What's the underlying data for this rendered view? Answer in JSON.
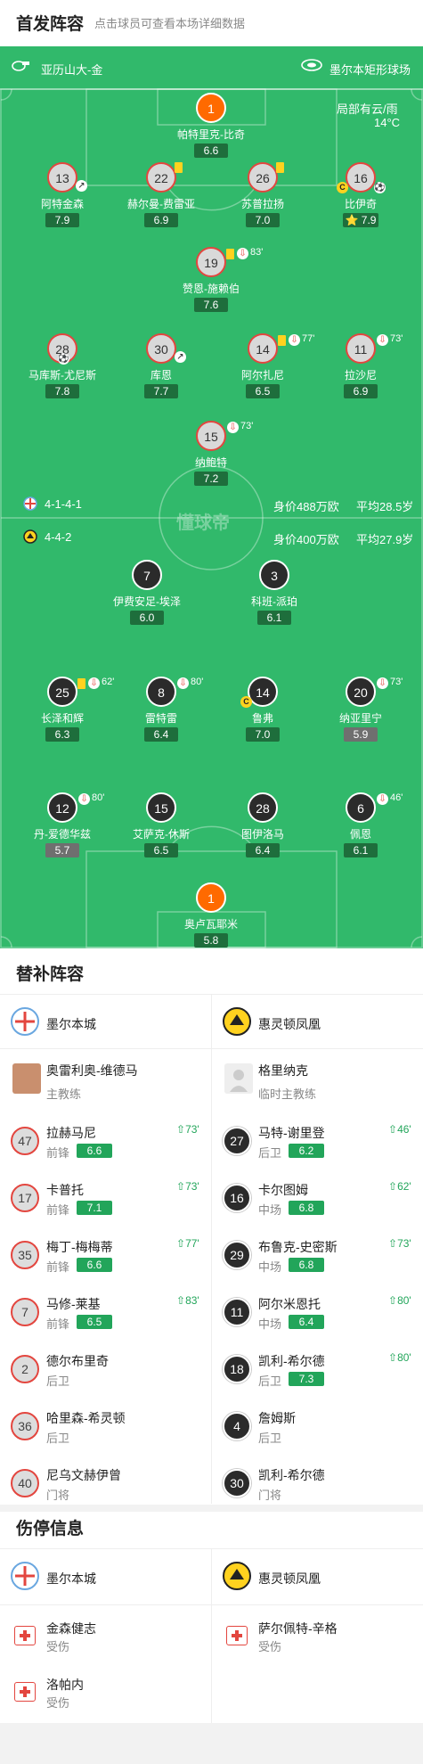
{
  "header": {
    "title": "首发阵容",
    "subtitle": "点击球员可查看本场详细数据"
  },
  "pitch": {
    "home_coach": "亚历山大-金",
    "stadium": "墨尔本矩形球场",
    "weather": "局部有云/雨",
    "temperature": "14°C",
    "watermark": "懂球帝"
  },
  "home": {
    "formation": "4-1-4-1",
    "value": "身价488万欧",
    "age": "平均28.5岁",
    "players": [
      {
        "num": "1",
        "name": "帕特里克-比奇",
        "rating": "6.6"
      },
      {
        "num": "13",
        "name": "阿特金森",
        "rating": "7.9"
      },
      {
        "num": "22",
        "name": "赫尔曼-费雷亚",
        "rating": "6.9"
      },
      {
        "num": "26",
        "name": "苏普拉扬",
        "rating": "7.0"
      },
      {
        "num": "16",
        "name": "比伊奇",
        "rating": "7.9"
      },
      {
        "num": "19",
        "name": "赞恩-施赖伯",
        "rating": "7.6",
        "minute": "83'"
      },
      {
        "num": "28",
        "name": "马库斯-尤尼斯",
        "rating": "7.8"
      },
      {
        "num": "30",
        "name": "库恩",
        "rating": "7.7"
      },
      {
        "num": "14",
        "name": "阿尔扎尼",
        "rating": "6.5",
        "minute": "77'"
      },
      {
        "num": "11",
        "name": "拉沙尼",
        "rating": "6.9",
        "minute": "73'"
      },
      {
        "num": "15",
        "name": "纳鲍特",
        "rating": "7.2",
        "minute": "73'"
      }
    ]
  },
  "away": {
    "formation": "4-4-2",
    "value": "身价400万欧",
    "age": "平均27.9岁",
    "players": [
      {
        "num": "7",
        "name": "伊费安足-埃泽",
        "rating": "6.0"
      },
      {
        "num": "3",
        "name": "科班-派珀",
        "rating": "6.1"
      },
      {
        "num": "25",
        "name": "长泽和辉",
        "rating": "6.3",
        "minute": "62'"
      },
      {
        "num": "8",
        "name": "雷特雷",
        "rating": "6.4",
        "minute": "80'"
      },
      {
        "num": "14",
        "name": "鲁弗",
        "rating": "7.0"
      },
      {
        "num": "20",
        "name": "纳亚里宁",
        "rating": "5.9",
        "minute": "73'"
      },
      {
        "num": "12",
        "name": "丹-爱德华兹",
        "rating": "5.7",
        "minute": "80'"
      },
      {
        "num": "15",
        "name": "艾萨克-休斯",
        "rating": "6.5"
      },
      {
        "num": "28",
        "name": "图伊洛马",
        "rating": "6.4"
      },
      {
        "num": "6",
        "name": "佩恩",
        "rating": "6.1",
        "minute": "46'"
      },
      {
        "num": "1",
        "name": "奥卢瓦耶米",
        "rating": "5.8"
      }
    ]
  },
  "subs": {
    "title": "替补阵容",
    "home_team": "墨尔本城",
    "away_team": "惠灵顿凤凰",
    "home_coach": {
      "name": "奥雷利奥-维德马",
      "role": "主教练"
    },
    "away_coach": {
      "name": "格里纳克",
      "role": "临时主教练"
    },
    "home": [
      {
        "num": "47",
        "name": "拉赫马尼",
        "pos": "前锋",
        "rating": "6.6",
        "in": "73'"
      },
      {
        "num": "17",
        "name": "卡普托",
        "pos": "前锋",
        "rating": "7.1",
        "in": "73'"
      },
      {
        "num": "35",
        "name": "梅丁-梅梅蒂",
        "pos": "前锋",
        "rating": "6.6",
        "in": "77'"
      },
      {
        "num": "7",
        "name": "马修-莱基",
        "pos": "前锋",
        "rating": "6.5",
        "in": "83'"
      },
      {
        "num": "2",
        "name": "德尔布里奇",
        "pos": "后卫"
      },
      {
        "num": "36",
        "name": "哈里森-希灵顿",
        "pos": "后卫"
      },
      {
        "num": "40",
        "name": "尼乌文赫伊曾",
        "pos": "门将"
      }
    ],
    "away": [
      {
        "num": "27",
        "name": "马特-谢里登",
        "pos": "后卫",
        "rating": "6.2",
        "in": "46'"
      },
      {
        "num": "16",
        "name": "卡尔图姆",
        "pos": "中场",
        "rating": "6.8",
        "in": "62'"
      },
      {
        "num": "29",
        "name": "布鲁克-史密斯",
        "pos": "中场",
        "rating": "6.8",
        "in": "73'"
      },
      {
        "num": "11",
        "name": "阿尔米恩托",
        "pos": "中场",
        "rating": "6.4",
        "in": "80'"
      },
      {
        "num": "18",
        "name": "凯利-希尔德",
        "pos": "后卫",
        "rating": "7.3",
        "in": "80'"
      },
      {
        "num": "4",
        "name": "詹姆斯",
        "pos": "后卫"
      },
      {
        "num": "30",
        "name": "凯利-希尔德",
        "pos": "门将"
      }
    ]
  },
  "injuries": {
    "title": "伤停信息",
    "home_team": "墨尔本城",
    "away_team": "惠灵顿凤凰",
    "home": [
      {
        "name": "金森健志",
        "status": "受伤"
      },
      {
        "name": "洛帕内",
        "status": "受伤"
      }
    ],
    "away": [
      {
        "name": "萨尔佩特-辛格",
        "status": "受伤"
      }
    ]
  },
  "icons": {
    "yellow_card": "yellow-card-icon",
    "sub_out": "sub-out-icon",
    "sub_in": "sub-in-icon",
    "goal": "football-icon",
    "captain": "captain-icon",
    "whistle": "whistle-icon",
    "stadium": "stadium-icon",
    "injury": "first-aid-icon"
  },
  "colors": {
    "pitch": "#31b96b",
    "home_ring": "#e3463f",
    "rating_good": "#22a55a",
    "goalkeeper": "#ff6a00",
    "yellow_card": "#ffd21f"
  }
}
